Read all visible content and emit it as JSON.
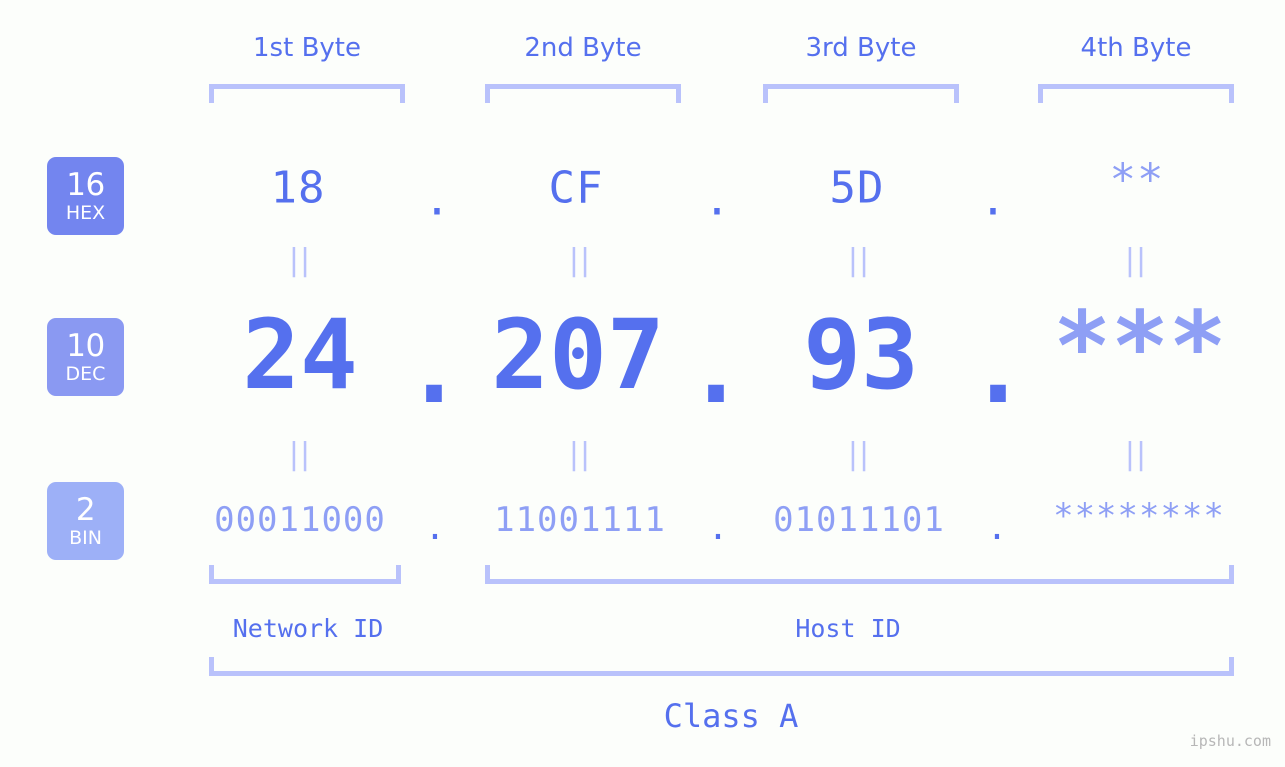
{
  "watermark": "ipshu.com",
  "byte_headers": [
    {
      "label": "1st Byte"
    },
    {
      "label": "2nd Byte"
    },
    {
      "label": "3rd Byte"
    },
    {
      "label": "4th Byte"
    }
  ],
  "bases": [
    {
      "num": "16",
      "name": "HEX",
      "color": "#7385ef"
    },
    {
      "num": "10",
      "name": "DEC",
      "color": "#8a99f2"
    },
    {
      "num": "2",
      "name": "BIN",
      "color": "#9db0f7"
    }
  ],
  "rows": {
    "hex": {
      "base_label": "HEX",
      "values": [
        "18",
        "CF",
        "5D",
        "**"
      ],
      "separator": "."
    },
    "dec": {
      "base_label": "DEC",
      "values": [
        "24",
        "207",
        "93",
        "***"
      ],
      "separator": "."
    },
    "bin": {
      "base_label": "BIN",
      "values": [
        "00011000",
        "11001111",
        "01011101",
        "********"
      ],
      "separator": "."
    }
  },
  "equality_marks": [
    "||",
    "||",
    "||",
    "||"
  ],
  "sections": [
    {
      "label": "Network ID"
    },
    {
      "label": "Host ID"
    }
  ],
  "class": {
    "label": "Class A"
  },
  "colors": {
    "background": "#fcfefb",
    "accent": "#5570ee",
    "accent_light": "#8e9ff5",
    "bracket": "#b9c2fb",
    "watermark": "#b7b7b7"
  }
}
